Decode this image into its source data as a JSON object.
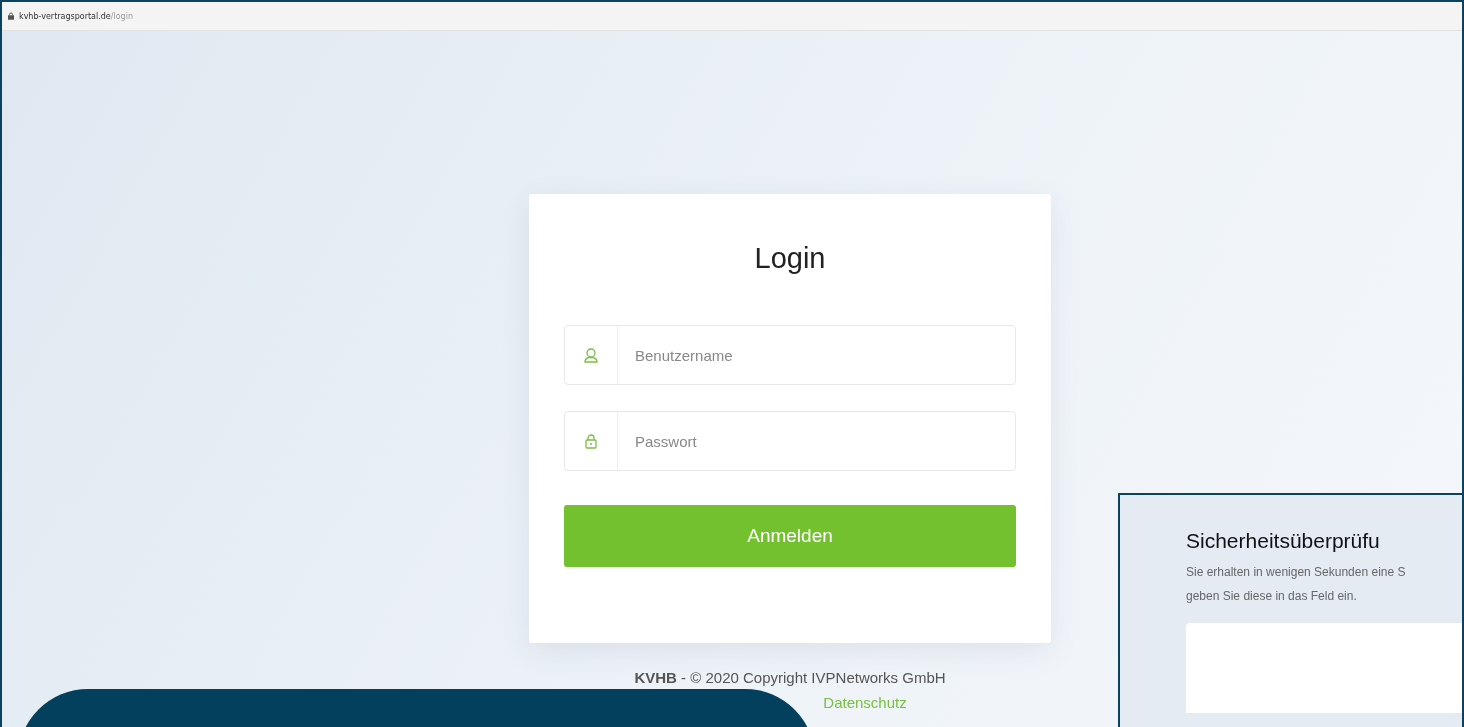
{
  "address_bar": {
    "domain": "kvhb-vertragsportal.de",
    "path": "/login"
  },
  "login": {
    "title": "Login",
    "fields": [
      {
        "kind": "user",
        "placeholder": "Benutzername"
      },
      {
        "kind": "lock",
        "placeholder": "Passwort"
      }
    ],
    "submit": "Anmelden"
  },
  "footer": {
    "brand": "KVHB",
    "copyright": " - © 2020 Copyright IVPNetworks GmbH",
    "link": "Datenschutz"
  },
  "sms_panel": {
    "title": "Sicherheitsüberprüfu",
    "lines": [
      "Sie erhalten in wenigen Sekunden eine S",
      "geben Sie diese in das Feld ein."
    ]
  }
}
